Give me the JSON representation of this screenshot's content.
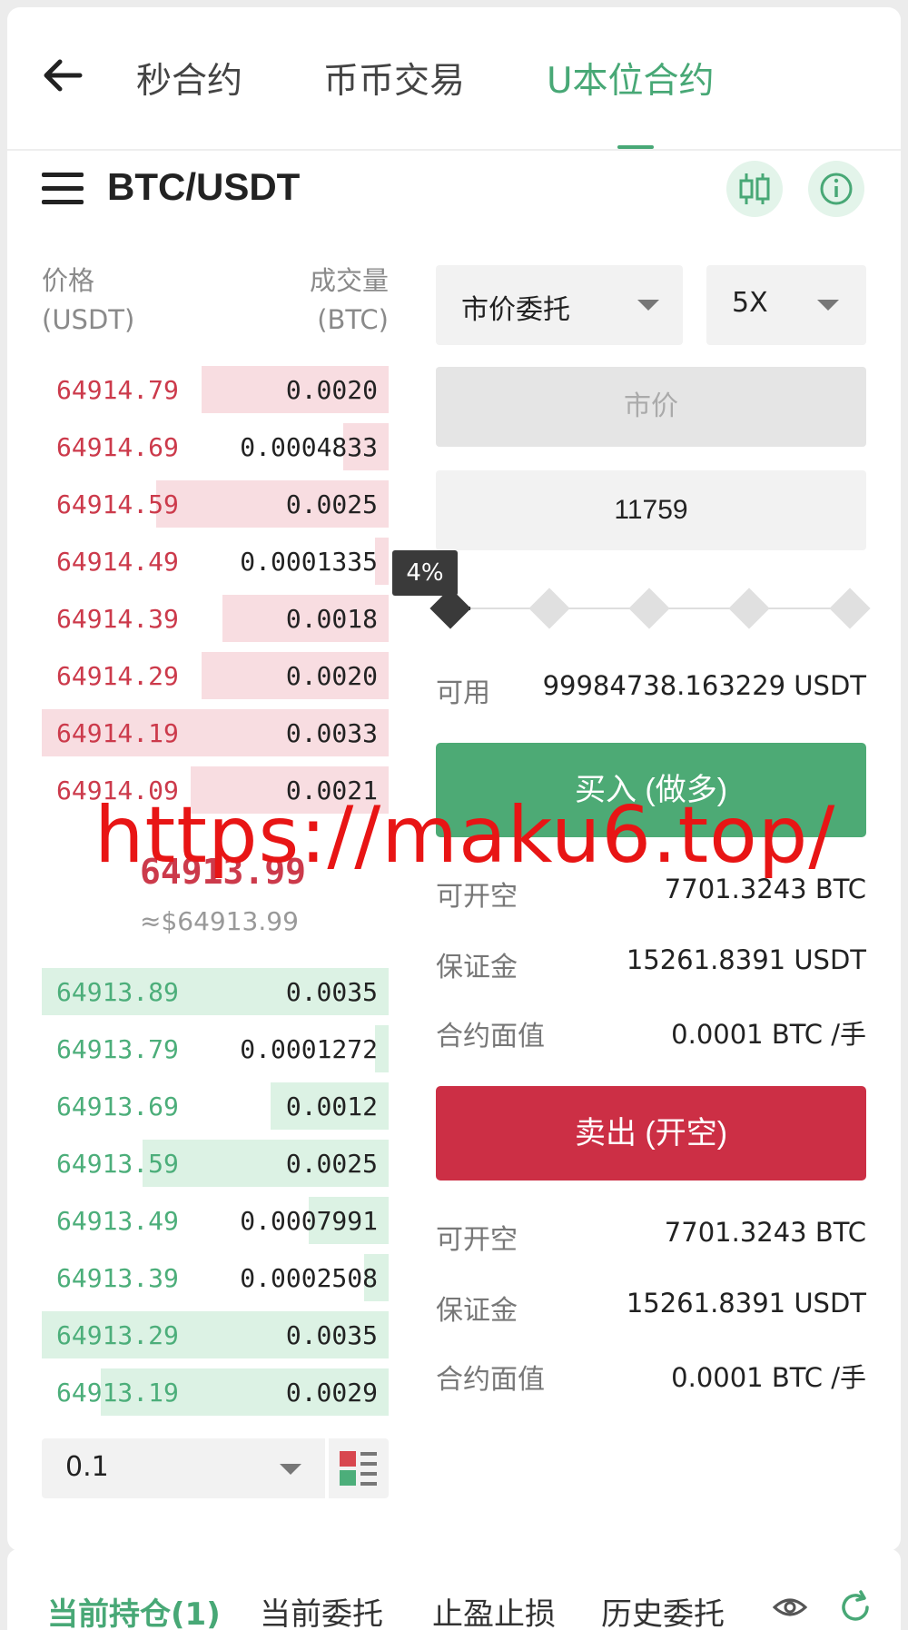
{
  "nav": {
    "tabs": [
      {
        "label": "秒合约"
      },
      {
        "label": "币币交易"
      },
      {
        "label": "U本位合约"
      }
    ]
  },
  "pair": "BTC/USDT",
  "orderbook": {
    "price_header": "价格",
    "price_unit": "(USDT)",
    "qty_header": "成交量",
    "qty_unit": "(BTC)",
    "asks": [
      {
        "price": "64914.79",
        "qty": "0.0020",
        "depth": 0.54
      },
      {
        "price": "64914.69",
        "qty": "0.0004833",
        "depth": 0.13
      },
      {
        "price": "64914.59",
        "qty": "0.0025",
        "depth": 0.67
      },
      {
        "price": "64914.49",
        "qty": "0.0001335",
        "depth": 0.04
      },
      {
        "price": "64914.39",
        "qty": "0.0018",
        "depth": 0.48
      },
      {
        "price": "64914.29",
        "qty": "0.0020",
        "depth": 0.54
      },
      {
        "price": "64914.19",
        "qty": "0.0033",
        "depth": 1.0
      },
      {
        "price": "64914.09",
        "qty": "0.0021",
        "depth": 0.57
      }
    ],
    "last_price": "64913.99",
    "last_price_usd": "≈$64913.99",
    "bids": [
      {
        "price": "64913.89",
        "qty": "0.0035",
        "depth": 1.0
      },
      {
        "price": "64913.79",
        "qty": "0.0001272",
        "depth": 0.04
      },
      {
        "price": "64913.69",
        "qty": "0.0012",
        "depth": 0.34
      },
      {
        "price": "64913.59",
        "qty": "0.0025",
        "depth": 0.71
      },
      {
        "price": "64913.49",
        "qty": "0.0007991",
        "depth": 0.23
      },
      {
        "price": "64913.39",
        "qty": "0.0002508",
        "depth": 0.07
      },
      {
        "price": "64913.29",
        "qty": "0.0035",
        "depth": 1.0
      },
      {
        "price": "64913.19",
        "qty": "0.0029",
        "depth": 0.83
      }
    ],
    "depth_step": "0.1"
  },
  "form": {
    "order_type": "市价委托",
    "leverage": "5X",
    "price_placeholder": "市价",
    "amount_value": "11759",
    "slider_percent": "4%",
    "slider_value": 0.04,
    "available_label": "可用",
    "available_value": "99984738.163229 USDT",
    "buy_label": "买入 (做多)",
    "buy_info": [
      {
        "label": "可开空",
        "value": "7701.3243 BTC"
      },
      {
        "label": "保证金",
        "value": "15261.8391 USDT"
      },
      {
        "label": "合约面值",
        "value": "0.0001 BTC /手"
      }
    ],
    "sell_label": "卖出 (开空)",
    "sell_info": [
      {
        "label": "可开空",
        "value": "7701.3243 BTC"
      },
      {
        "label": "保证金",
        "value": "15261.8391 USDT"
      },
      {
        "label": "合约面值",
        "value": "0.0001 BTC /手"
      }
    ]
  },
  "watermark": "https://maku6.top/",
  "bottom_tabs": [
    {
      "label": "当前持仓(1)"
    },
    {
      "label": "当前委托"
    },
    {
      "label": "止盈止损"
    },
    {
      "label": "历史委托"
    }
  ],
  "colors": {
    "accent": "#48a876",
    "ask": "#cc3a4b",
    "bid": "#4cae7a",
    "buy_button": "#4daa75",
    "sell_button": "#cc2f45",
    "watermark": "#e81515"
  },
  "icons": [
    "back-arrow-icon",
    "menu-icon",
    "candlestick-chart-icon",
    "info-icon",
    "chevron-down-icon",
    "orderbook-layout-icon",
    "eye-icon",
    "refresh-icon"
  ]
}
